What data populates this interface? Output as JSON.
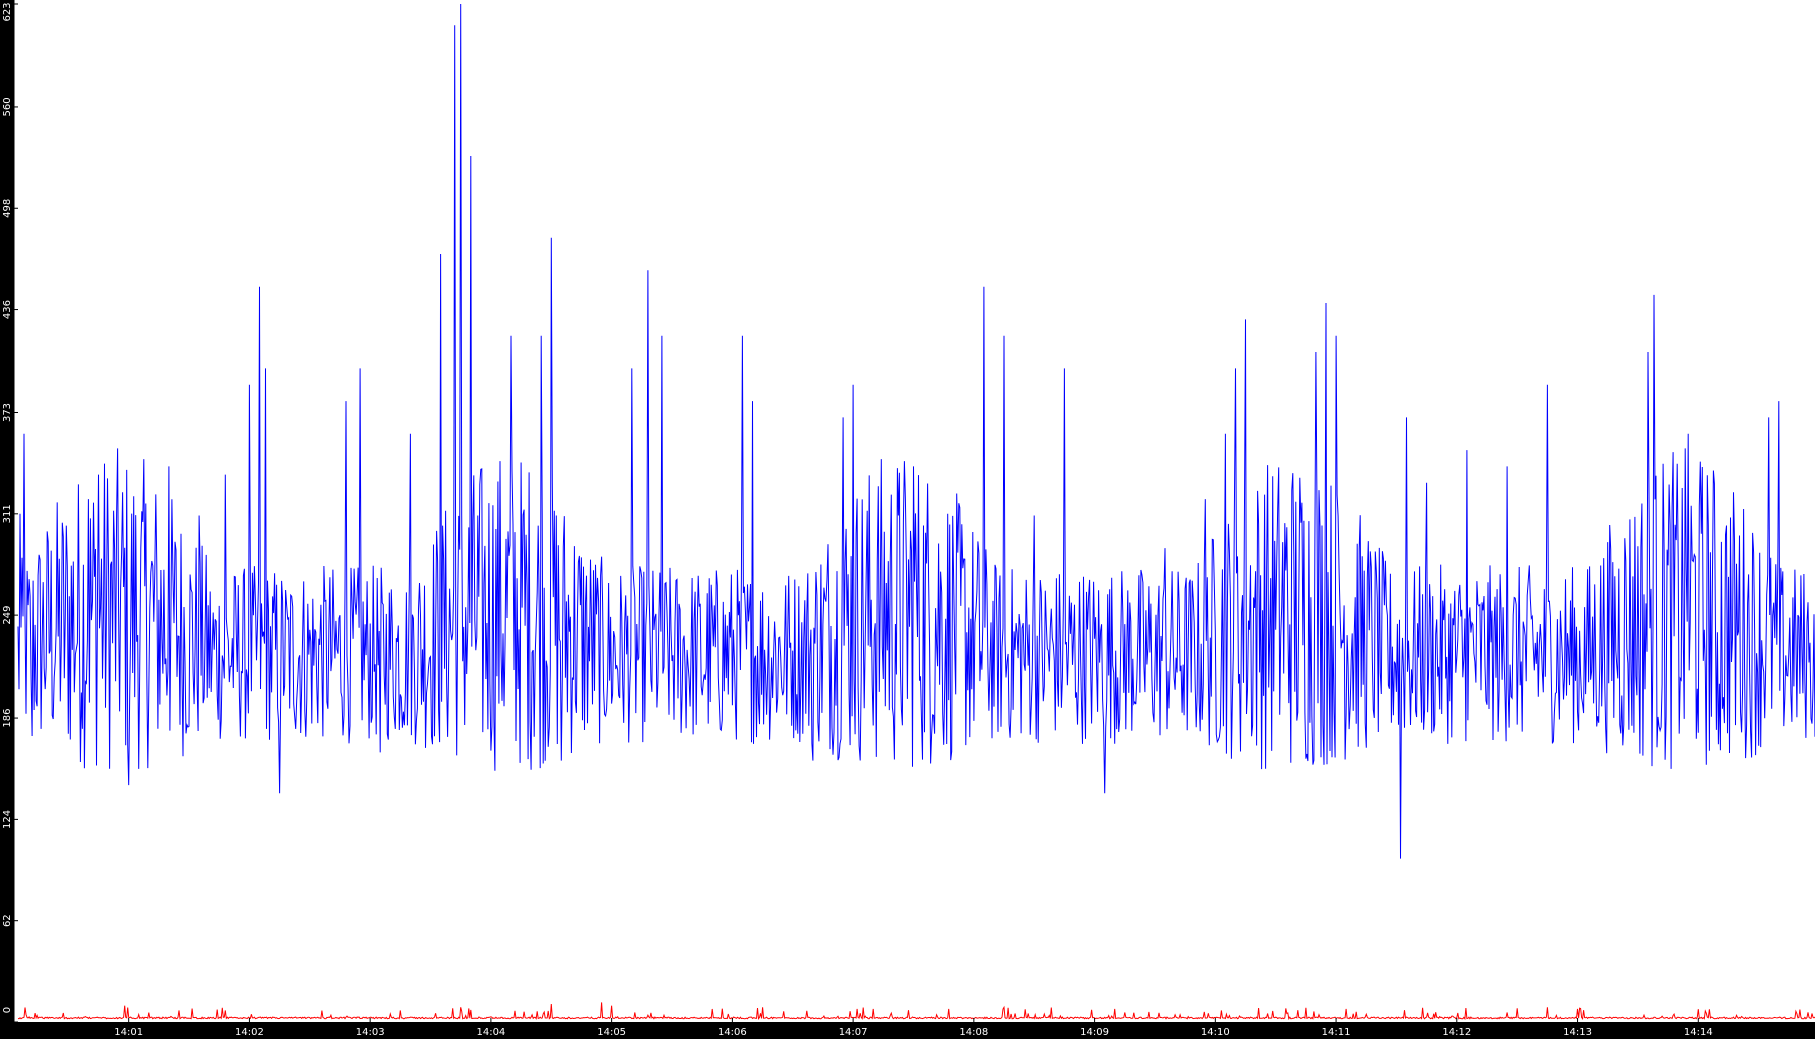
{
  "chart_data": {
    "type": "line",
    "title": "",
    "xlabel": "",
    "ylabel": "",
    "grid": false,
    "legend": "none",
    "ylim": [
      0,
      623
    ],
    "xlim": [
      "14:00:05",
      "14:14:58"
    ],
    "y_ticks": [
      "0",
      "62",
      "124",
      "186",
      "249",
      "311",
      "373",
      "436",
      "498",
      "560",
      "623"
    ],
    "x_ticks": [
      "14:01",
      "14:02",
      "14:03",
      "14:04",
      "14:05",
      "14:06",
      "14:07",
      "14:08",
      "14:09",
      "14:10",
      "14:11",
      "14:12",
      "14:13",
      "14:14"
    ],
    "series": [
      {
        "color": "#0000ff",
        "baseline": 225,
        "spikes": [
          [
            "14:00:06",
            311
          ],
          [
            "14:00:08",
            360
          ],
          [
            "14:00:12",
            175
          ],
          [
            "14:00:40",
            320
          ],
          [
            "14:00:45",
            335
          ],
          [
            "14:01:00",
            145
          ],
          [
            "14:01:20",
            340
          ],
          [
            "14:01:35",
            310
          ],
          [
            "14:01:48",
            335
          ],
          [
            "14:02:00",
            390
          ],
          [
            "14:02:05",
            450
          ],
          [
            "14:02:08",
            400
          ],
          [
            "14:02:15",
            140
          ],
          [
            "14:02:48",
            380
          ],
          [
            "14:02:55",
            400
          ],
          [
            "14:03:05",
            165
          ],
          [
            "14:03:20",
            360
          ],
          [
            "14:03:35",
            470
          ],
          [
            "14:03:42",
            610
          ],
          [
            "14:03:45",
            623
          ],
          [
            "14:03:50",
            530
          ],
          [
            "14:04:10",
            420
          ],
          [
            "14:04:25",
            420
          ],
          [
            "14:04:30",
            480
          ],
          [
            "14:04:35",
            160
          ],
          [
            "14:05:10",
            400
          ],
          [
            "14:05:18",
            460
          ],
          [
            "14:05:25",
            420
          ],
          [
            "14:05:45",
            200
          ],
          [
            "14:06:05",
            420
          ],
          [
            "14:06:10",
            380
          ],
          [
            "14:06:40",
            160
          ],
          [
            "14:06:55",
            370
          ],
          [
            "14:07:00",
            390
          ],
          [
            "14:07:30",
            340
          ],
          [
            "14:08:05",
            450
          ],
          [
            "14:08:15",
            420
          ],
          [
            "14:08:30",
            310
          ],
          [
            "14:08:45",
            400
          ],
          [
            "14:09:05",
            140
          ],
          [
            "14:09:35",
            290
          ],
          [
            "14:09:55",
            320
          ],
          [
            "14:10:05",
            360
          ],
          [
            "14:10:10",
            400
          ],
          [
            "14:10:15",
            430
          ],
          [
            "14:10:30",
            240
          ],
          [
            "14:10:50",
            410
          ],
          [
            "14:10:55",
            440
          ],
          [
            "14:11:00",
            420
          ],
          [
            "14:11:32",
            100
          ],
          [
            "14:11:35",
            370
          ],
          [
            "14:11:45",
            330
          ],
          [
            "14:12:05",
            350
          ],
          [
            "14:12:25",
            340
          ],
          [
            "14:12:45",
            390
          ],
          [
            "14:13:00",
            190
          ],
          [
            "14:13:35",
            410
          ],
          [
            "14:13:38",
            445
          ],
          [
            "14:13:55",
            360
          ],
          [
            "14:14:10",
            170
          ],
          [
            "14:14:35",
            370
          ],
          [
            "14:14:40",
            380
          ],
          [
            "14:14:55",
            220
          ]
        ]
      },
      {
        "color": "#ff0000",
        "baseline": 2,
        "spikes": [
          [
            "14:00:58",
            10
          ],
          [
            "14:03:45",
            9
          ],
          [
            "14:04:30",
            11
          ],
          [
            "14:04:55",
            12
          ],
          [
            "14:05:00",
            10
          ],
          [
            "14:06:15",
            9
          ],
          [
            "14:07:10",
            8
          ],
          [
            "14:08:15",
            9
          ],
          [
            "14:09:10",
            8
          ],
          [
            "14:11:05",
            8
          ],
          [
            "14:12:45",
            9
          ],
          [
            "14:13:00",
            8
          ]
        ]
      }
    ]
  }
}
